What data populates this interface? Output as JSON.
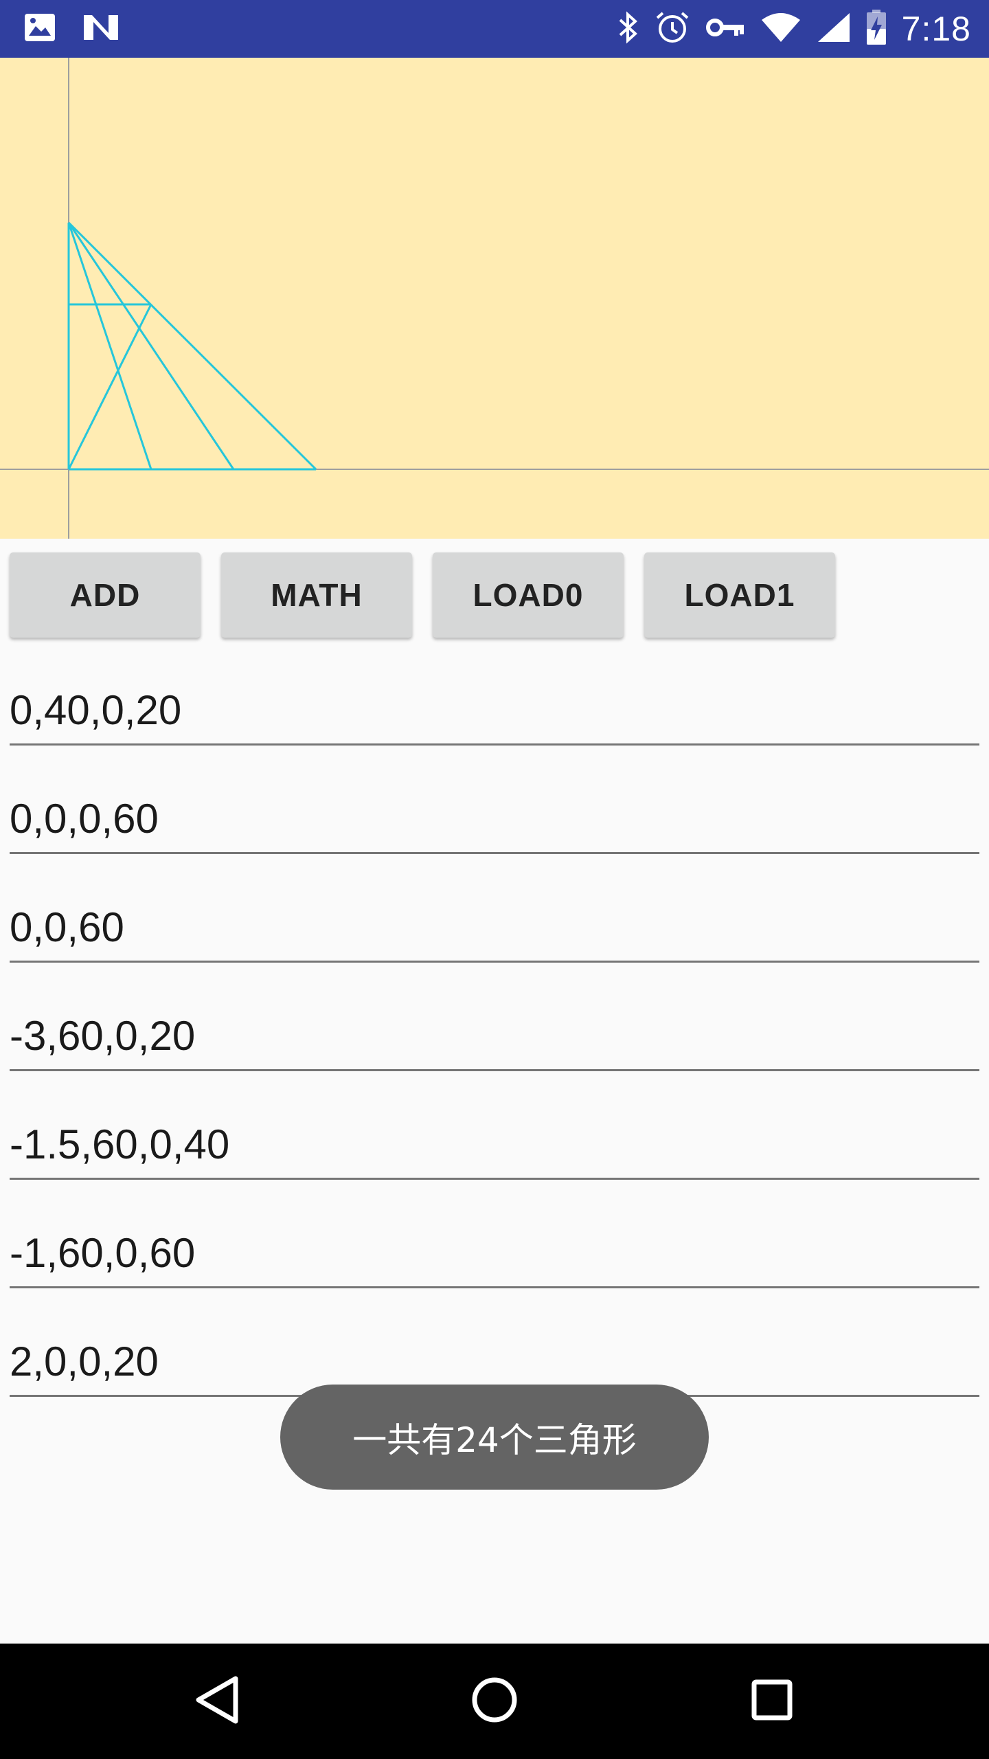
{
  "status_bar": {
    "time": "7:18",
    "left_icons": [
      "image-icon",
      "n-logo-icon"
    ],
    "right_icons": [
      "bluetooth-icon",
      "alarm-icon",
      "vpn-key-icon",
      "wifi-icon",
      "signal-icon",
      "battery-charging-icon"
    ]
  },
  "canvas": {
    "background": "#ffecb3",
    "axis_color": "#9e9e9e",
    "line_color": "#26c6da"
  },
  "buttons": {
    "add": "ADD",
    "math": "MATH",
    "load0": "LOAD0",
    "load1": "LOAD1"
  },
  "fields": [
    "0,40,0,20",
    "0,0,0,60",
    "0,0,60",
    "-3,60,0,20",
    "-1.5,60,0,40",
    "-1,60,0,60",
    "2,0,0,20"
  ],
  "toast": {
    "message": "一共有24个三角形"
  },
  "nav_bar": {
    "icons": [
      "back-icon",
      "home-icon",
      "recents-icon"
    ]
  }
}
